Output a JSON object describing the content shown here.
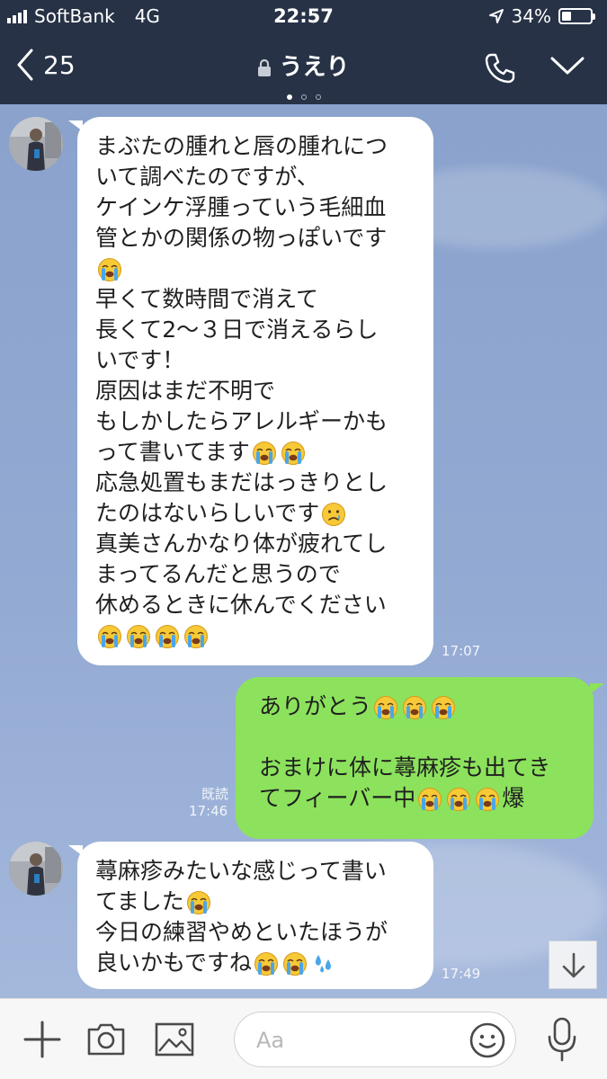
{
  "status_bar": {
    "carrier": "SoftBank",
    "network": "4G",
    "time": "22:57",
    "battery": "34%",
    "battery_level": 0.34
  },
  "header": {
    "back_count": "25",
    "chat_name": "うえり",
    "page_dots": 3,
    "active_dot": 0
  },
  "messages": [
    {
      "side": "in",
      "lines": [
        "まぶたの腫れと唇の腫れにつ",
        "いて調べたのですが、",
        "ケインケ浮腫っていう毛細血",
        "管とかの関係の物っぽいです",
        "{crying}",
        "早くて数時間で消えて",
        "長くて2〜３日で消えるらし",
        "いです！",
        "原因はまだ不明で",
        "もしかしたらアレルギーかも",
        "って書いてます{crying}{crying}",
        "応急処置もまだはっきりとし",
        "たのはないらしいです{sad}",
        "真美さんかなり体が疲れてし",
        "まってるんだと思うので",
        "休めるときに休んでください",
        "{crying}{crying}{crying}{crying}"
      ],
      "time": "17:07"
    },
    {
      "side": "out",
      "lines": [
        "ありがとう{crying}{crying}{crying}",
        "",
        "おまけに体に蕁麻疹も出てき",
        "てフィーバー中{crying}{crying}{crying}爆"
      ],
      "read_label": "既読",
      "time": "17:46"
    },
    {
      "side": "in",
      "lines": [
        "蕁麻疹みたいな感じって書い",
        "てました{crying}",
        "今日の練習やめといたほうが",
        "良いかもですね{crying}{crying}{sweat}"
      ],
      "time": "17:49"
    }
  ],
  "input": {
    "placeholder": "Aa"
  },
  "icons": {
    "back": "chevron-left-icon",
    "lock": "lock-icon",
    "call": "phone-icon",
    "menu": "chevron-down-icon",
    "scroll": "arrow-down-icon",
    "add": "plus-icon",
    "camera": "camera-icon",
    "image": "image-icon",
    "emoji": "smiley-icon",
    "voice": "microphone-icon"
  },
  "colors": {
    "header_bg": "#273246",
    "chat_bg": "#8ea5cf",
    "incoming_bubble": "#ffffff",
    "outgoing_bubble": "#8ce25c"
  }
}
